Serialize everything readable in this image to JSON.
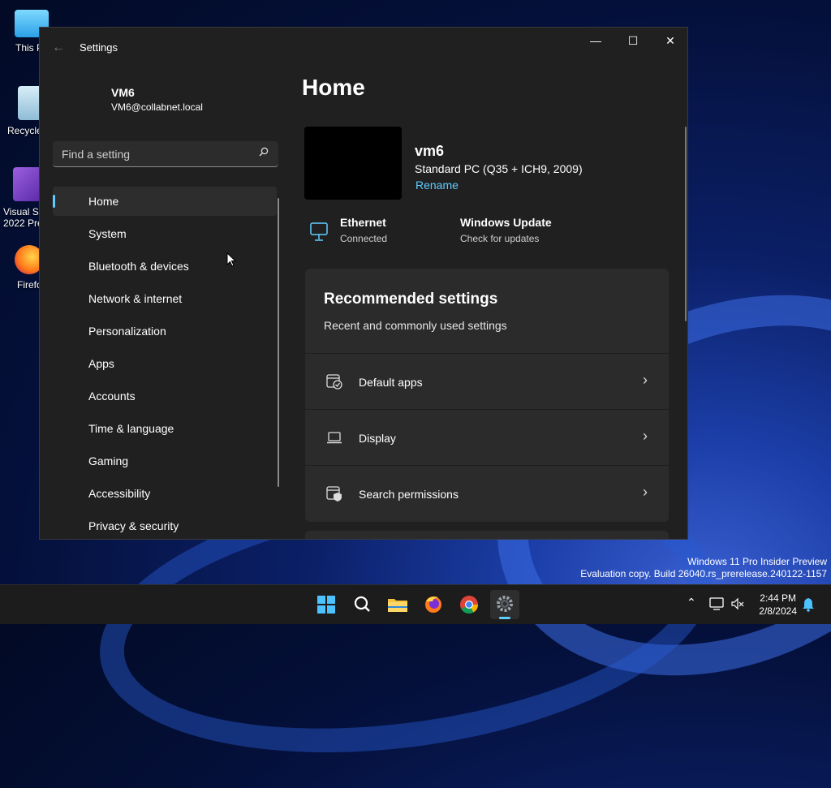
{
  "desktop": {
    "icons": [
      {
        "label": "This P",
        "icon": "monitor-icon"
      },
      {
        "label": "Recycle",
        "icon": "recycle-bin-icon"
      },
      {
        "label": "Visual St\n2022 Pre",
        "icon": "visual-studio-icon"
      },
      {
        "label": "Firefo",
        "icon": "firefox-icon"
      }
    ],
    "watermark": {
      "line1": "Windows 11 Pro Insider Preview",
      "line2": "Evaluation copy. Build 26040.rs_prerelease.240122-1157"
    }
  },
  "window": {
    "title": "Settings",
    "back_icon": "back-arrow-icon",
    "controls": {
      "minimize": "—",
      "maximize": "☐",
      "close": "✕"
    }
  },
  "profile": {
    "name": "VM6",
    "email": "VM6@collabnet.local"
  },
  "search": {
    "placeholder": "Find a setting",
    "icon": "search-icon"
  },
  "nav": {
    "items": [
      {
        "label": "Home",
        "active": true
      },
      {
        "label": "System"
      },
      {
        "label": "Bluetooth & devices"
      },
      {
        "label": "Network & internet"
      },
      {
        "label": "Personalization"
      },
      {
        "label": "Apps"
      },
      {
        "label": "Accounts"
      },
      {
        "label": "Time & language"
      },
      {
        "label": "Gaming"
      },
      {
        "label": "Accessibility"
      },
      {
        "label": "Privacy & security"
      }
    ]
  },
  "main": {
    "title": "Home",
    "device": {
      "name": "vm6",
      "description": "Standard PC (Q35 + ICH9, 2009)",
      "rename": "Rename"
    },
    "status": {
      "ethernet": {
        "title": "Ethernet",
        "subtitle": "Connected",
        "icon": "ethernet-icon"
      },
      "update": {
        "title": "Windows Update",
        "subtitle": "Check for updates"
      }
    },
    "recommended": {
      "title": "Recommended settings",
      "subtitle": "Recent and commonly used settings",
      "rows": [
        {
          "label": "Default apps",
          "icon": "default-apps-icon"
        },
        {
          "label": "Display",
          "icon": "laptop-display-icon"
        },
        {
          "label": "Search permissions",
          "icon": "search-permissions-icon"
        }
      ]
    }
  },
  "taskbar": {
    "apps": [
      "start-icon",
      "search-icon",
      "file-explorer-icon",
      "firefox-icon",
      "chrome-icon",
      "settings-icon"
    ],
    "active_app": "settings-icon",
    "clock": {
      "time": "2:44 PM",
      "date": "2/8/2024"
    },
    "accent": "#60cdff"
  }
}
